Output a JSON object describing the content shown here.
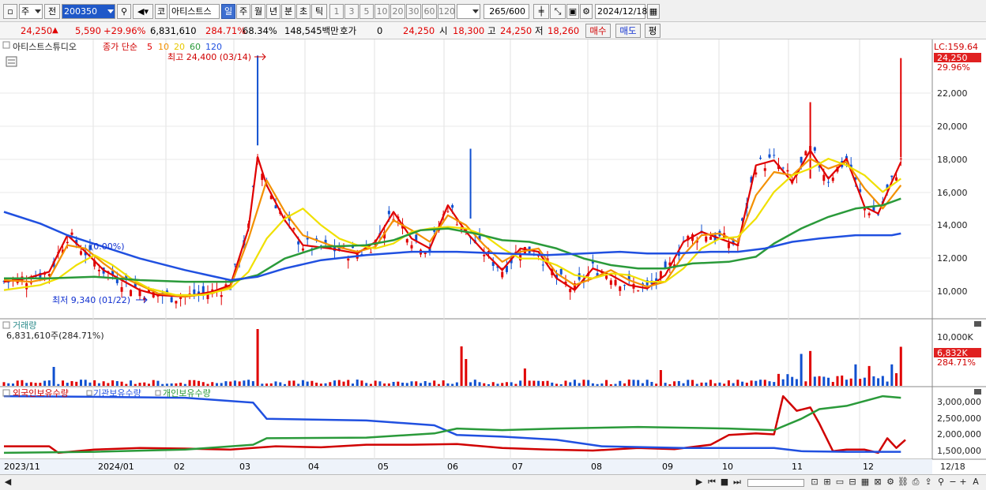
{
  "toolbar": {
    "period_primary": "주",
    "prev_label": "전",
    "code": "200350",
    "market_label": "코",
    "stock_name": "아티스트스",
    "timeframes": [
      "일",
      "주",
      "월",
      "년",
      "분",
      "초",
      "틱"
    ],
    "active_timeframe": "일",
    "intervals": [
      "1",
      "3",
      "5",
      "10",
      "20",
      "30",
      "60",
      "120"
    ],
    "count": "265",
    "count_total": "/600",
    "date": "2024/12/18"
  },
  "quote": {
    "price": "24,250",
    "change": "5,590",
    "change_pct": "+29.96%",
    "volume": "6,831,610",
    "volume_ratio": "284.71%",
    "turnover_ratio": "68.34%",
    "trade_value": "148,545백만",
    "hoga_label": "호가",
    "hoga_value": "0",
    "hoga_price": "24,250",
    "open_label": "시",
    "open": "18,300",
    "high_label": "고",
    "high": "24,250",
    "low_label": "저",
    "low": "18,260",
    "buy_label": "매수",
    "sell_label": "매도",
    "eval_label": "평"
  },
  "legend": {
    "stock": "아티스트스튜디오",
    "ma_label": "종가 단순",
    "periods": [
      "5",
      "10",
      "20",
      "60",
      "120"
    ],
    "period_colors": [
      "#e00000",
      "#f39000",
      "#f0e000",
      "#2a9a3a",
      "#2050e0"
    ]
  },
  "annotations": {
    "high": "최고 24,400 (03/14)",
    "low": "최저 9,340 (01/22)",
    "mid": "(0.00%)"
  },
  "price_axis": {
    "top_label": "LC:159.64",
    "current": "24,250",
    "current_pct": "29.96%",
    "ticks": [
      "22,000",
      "20,000",
      "18,000",
      "16,000",
      "14,000",
      "12,000",
      "10,000"
    ]
  },
  "volume_panel": {
    "title": "거래량",
    "value": "6,831,610주(284.71%)",
    "axis_tick": "10,000K",
    "current": "6,832K",
    "current_pct": "284.71%"
  },
  "holdings_panel": {
    "legends": [
      "외국인보유수량",
      "기관보유수량",
      "개인보유수량"
    ],
    "colors": [
      "#d00000",
      "#2050e0",
      "#2a9a3a"
    ],
    "ticks": [
      "3,000,000",
      "2,500,000",
      "2,000,000",
      "1,500,000"
    ]
  },
  "x_axis": {
    "labels": [
      "2023/11",
      "2024/01",
      "02",
      "03",
      "04",
      "05",
      "06",
      "07",
      "08",
      "09",
      "10",
      "11",
      "12"
    ],
    "end_label": "12/18"
  },
  "chart_data": {
    "type": "line",
    "price_ylim": [
      9000,
      24800
    ],
    "ma_series": [
      {
        "name": "5",
        "values": [
          [
            0,
            10.8
          ],
          [
            5,
            11.0
          ],
          [
            10,
            11.4
          ],
          [
            14,
            13.6
          ],
          [
            18,
            12.6
          ],
          [
            22,
            11.5
          ],
          [
            26,
            10.9
          ],
          [
            30,
            10.3
          ],
          [
            34,
            10.0
          ],
          [
            40,
            9.9
          ],
          [
            46,
            10.2
          ],
          [
            50,
            10.6
          ],
          [
            54,
            14.0
          ],
          [
            56,
            18.3
          ],
          [
            58,
            16.6
          ],
          [
            62,
            14.5
          ],
          [
            66,
            13.0
          ],
          [
            72,
            12.8
          ],
          [
            78,
            12.5
          ],
          [
            82,
            13.2
          ],
          [
            86,
            15.0
          ],
          [
            90,
            13.4
          ],
          [
            94,
            12.8
          ],
          [
            98,
            15.4
          ],
          [
            102,
            13.8
          ],
          [
            106,
            12.6
          ],
          [
            110,
            11.5
          ],
          [
            114,
            12.8
          ],
          [
            118,
            12.6
          ],
          [
            122,
            11.0
          ],
          [
            126,
            10.3
          ],
          [
            130,
            11.6
          ],
          [
            134,
            11.2
          ],
          [
            138,
            10.6
          ],
          [
            142,
            10.4
          ],
          [
            146,
            11.2
          ],
          [
            150,
            13.2
          ],
          [
            154,
            13.8
          ],
          [
            158,
            13.4
          ],
          [
            162,
            13.0
          ],
          [
            166,
            17.8
          ],
          [
            170,
            18.1
          ],
          [
            174,
            16.8
          ],
          [
            178,
            18.7
          ],
          [
            182,
            17.0
          ],
          [
            186,
            18.2
          ],
          [
            190,
            15.3
          ],
          [
            193,
            14.9
          ],
          [
            196,
            16.8
          ],
          [
            198,
            18.0
          ]
        ]
      },
      {
        "name": "10",
        "values": [
          [
            0,
            10.9
          ],
          [
            6,
            10.8
          ],
          [
            10,
            11.0
          ],
          [
            14,
            13.0
          ],
          [
            18,
            12.8
          ],
          [
            22,
            11.9
          ],
          [
            26,
            11.1
          ],
          [
            30,
            10.6
          ],
          [
            34,
            10.1
          ],
          [
            40,
            9.9
          ],
          [
            46,
            10.1
          ],
          [
            50,
            10.5
          ],
          [
            54,
            13.4
          ],
          [
            58,
            16.9
          ],
          [
            62,
            15.0
          ],
          [
            66,
            13.6
          ],
          [
            72,
            13.0
          ],
          [
            78,
            12.6
          ],
          [
            82,
            12.9
          ],
          [
            86,
            14.5
          ],
          [
            90,
            13.9
          ],
          [
            94,
            13.2
          ],
          [
            98,
            14.8
          ],
          [
            102,
            14.2
          ],
          [
            106,
            13.0
          ],
          [
            110,
            12.0
          ],
          [
            114,
            12.6
          ],
          [
            118,
            12.8
          ],
          [
            122,
            11.3
          ],
          [
            126,
            10.6
          ],
          [
            130,
            11.0
          ],
          [
            134,
            11.5
          ],
          [
            138,
            10.9
          ],
          [
            142,
            10.5
          ],
          [
            146,
            10.8
          ],
          [
            150,
            12.4
          ],
          [
            154,
            13.6
          ],
          [
            158,
            13.7
          ],
          [
            162,
            13.2
          ],
          [
            166,
            16.0
          ],
          [
            170,
            17.4
          ],
          [
            174,
            17.2
          ],
          [
            178,
            18.2
          ],
          [
            182,
            17.6
          ],
          [
            186,
            18.0
          ],
          [
            190,
            16.4
          ],
          [
            194,
            15.2
          ],
          [
            198,
            16.6
          ]
        ]
      },
      {
        "name": "20",
        "values": [
          [
            0,
            10.3
          ],
          [
            8,
            10.6
          ],
          [
            12,
            11.0
          ],
          [
            16,
            11.8
          ],
          [
            20,
            12.4
          ],
          [
            24,
            11.8
          ],
          [
            28,
            11.0
          ],
          [
            32,
            10.4
          ],
          [
            38,
            10.0
          ],
          [
            44,
            10.0
          ],
          [
            50,
            10.4
          ],
          [
            54,
            11.4
          ],
          [
            58,
            13.4
          ],
          [
            62,
            14.6
          ],
          [
            66,
            15.2
          ],
          [
            70,
            14.2
          ],
          [
            74,
            13.4
          ],
          [
            78,
            13.0
          ],
          [
            82,
            12.8
          ],
          [
            86,
            13.1
          ],
          [
            90,
            13.8
          ],
          [
            94,
            14.0
          ],
          [
            98,
            14.1
          ],
          [
            102,
            14.0
          ],
          [
            106,
            13.6
          ],
          [
            110,
            12.8
          ],
          [
            114,
            12.2
          ],
          [
            118,
            12.2
          ],
          [
            122,
            11.8
          ],
          [
            126,
            11.2
          ],
          [
            130,
            11.0
          ],
          [
            134,
            11.3
          ],
          [
            138,
            11.2
          ],
          [
            142,
            10.8
          ],
          [
            146,
            10.8
          ],
          [
            150,
            11.6
          ],
          [
            154,
            12.8
          ],
          [
            158,
            13.4
          ],
          [
            162,
            13.5
          ],
          [
            166,
            14.6
          ],
          [
            170,
            16.2
          ],
          [
            174,
            17.2
          ],
          [
            178,
            17.6
          ],
          [
            182,
            18.2
          ],
          [
            186,
            17.8
          ],
          [
            190,
            17.2
          ],
          [
            194,
            16.2
          ],
          [
            198,
            17.0
          ]
        ]
      },
      {
        "name": "60",
        "values": [
          [
            0,
            11.0
          ],
          [
            10,
            11.0
          ],
          [
            20,
            11.1
          ],
          [
            30,
            10.9
          ],
          [
            40,
            10.8
          ],
          [
            50,
            10.8
          ],
          [
            56,
            11.2
          ],
          [
            62,
            12.2
          ],
          [
            70,
            12.9
          ],
          [
            80,
            13.0
          ],
          [
            86,
            13.3
          ],
          [
            92,
            13.9
          ],
          [
            98,
            14.0
          ],
          [
            104,
            13.7
          ],
          [
            110,
            13.3
          ],
          [
            116,
            13.2
          ],
          [
            122,
            12.8
          ],
          [
            128,
            12.2
          ],
          [
            134,
            11.8
          ],
          [
            140,
            11.6
          ],
          [
            146,
            11.6
          ],
          [
            152,
            11.9
          ],
          [
            160,
            12.0
          ],
          [
            166,
            12.3
          ],
          [
            170,
            13.1
          ],
          [
            176,
            14.0
          ],
          [
            182,
            14.7
          ],
          [
            188,
            15.2
          ],
          [
            194,
            15.4
          ],
          [
            198,
            15.8
          ]
        ]
      },
      {
        "name": "120",
        "values": [
          [
            0,
            15.0
          ],
          [
            8,
            14.3
          ],
          [
            14,
            13.6
          ],
          [
            22,
            12.9
          ],
          [
            30,
            12.2
          ],
          [
            40,
            11.5
          ],
          [
            50,
            10.9
          ],
          [
            56,
            11.1
          ],
          [
            62,
            11.6
          ],
          [
            70,
            12.1
          ],
          [
            80,
            12.4
          ],
          [
            90,
            12.6
          ],
          [
            100,
            12.6
          ],
          [
            110,
            12.5
          ],
          [
            120,
            12.4
          ],
          [
            128,
            12.5
          ],
          [
            136,
            12.6
          ],
          [
            142,
            12.5
          ],
          [
            148,
            12.5
          ],
          [
            156,
            12.6
          ],
          [
            162,
            12.6
          ],
          [
            168,
            12.8
          ],
          [
            174,
            13.2
          ],
          [
            180,
            13.4
          ],
          [
            188,
            13.6
          ],
          [
            196,
            13.6
          ],
          [
            198,
            13.7
          ]
        ]
      }
    ],
    "holdings_ylim": [
      1200000,
      3200000
    ],
    "holdings_series": [
      {
        "name": "외국인보유수량",
        "values": [
          [
            0,
            1.55
          ],
          [
            10,
            1.55
          ],
          [
            12,
            1.35
          ],
          [
            20,
            1.45
          ],
          [
            30,
            1.5
          ],
          [
            40,
            1.48
          ],
          [
            50,
            1.45
          ],
          [
            60,
            1.55
          ],
          [
            70,
            1.52
          ],
          [
            80,
            1.6
          ],
          [
            90,
            1.6
          ],
          [
            100,
            1.62
          ],
          [
            110,
            1.5
          ],
          [
            120,
            1.45
          ],
          [
            130,
            1.42
          ],
          [
            140,
            1.5
          ],
          [
            148,
            1.46
          ],
          [
            156,
            1.6
          ],
          [
            160,
            1.9
          ],
          [
            166,
            1.95
          ],
          [
            170,
            1.92
          ],
          [
            172,
            3.1
          ],
          [
            175,
            2.65
          ],
          [
            178,
            2.75
          ],
          [
            180,
            2.25
          ],
          [
            183,
            1.4
          ],
          [
            186,
            1.45
          ],
          [
            190,
            1.45
          ],
          [
            193,
            1.35
          ],
          [
            195,
            1.8
          ],
          [
            197,
            1.5
          ],
          [
            199,
            1.75
          ]
        ]
      },
      {
        "name": "기관보유수량",
        "values": [
          [
            0,
            3.1
          ],
          [
            20,
            3.08
          ],
          [
            40,
            3.05
          ],
          [
            55,
            2.9
          ],
          [
            58,
            2.4
          ],
          [
            80,
            2.35
          ],
          [
            95,
            2.2
          ],
          [
            100,
            1.9
          ],
          [
            110,
            1.85
          ],
          [
            122,
            1.75
          ],
          [
            132,
            1.55
          ],
          [
            150,
            1.5
          ],
          [
            170,
            1.5
          ],
          [
            176,
            1.4
          ],
          [
            186,
            1.38
          ],
          [
            198,
            1.38
          ]
        ]
      },
      {
        "name": "개인보유수량",
        "values": [
          [
            0,
            1.35
          ],
          [
            20,
            1.38
          ],
          [
            40,
            1.45
          ],
          [
            55,
            1.6
          ],
          [
            58,
            1.8
          ],
          [
            80,
            1.82
          ],
          [
            95,
            1.95
          ],
          [
            100,
            2.1
          ],
          [
            110,
            2.05
          ],
          [
            122,
            2.1
          ],
          [
            140,
            2.15
          ],
          [
            160,
            2.1
          ],
          [
            170,
            2.05
          ],
          [
            176,
            2.4
          ],
          [
            180,
            2.7
          ],
          [
            186,
            2.8
          ],
          [
            194,
            3.1
          ],
          [
            198,
            3.05
          ]
        ]
      }
    ]
  }
}
